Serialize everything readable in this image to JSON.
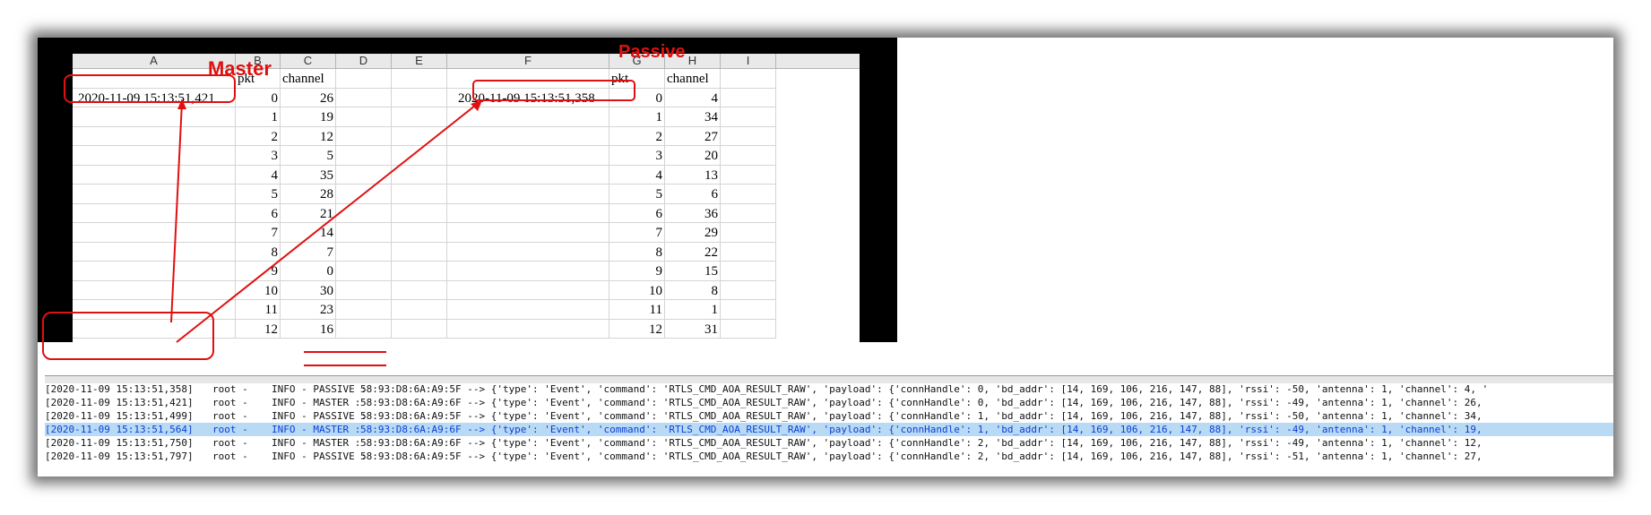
{
  "sheet": {
    "columns": [
      "A",
      "B",
      "C",
      "D",
      "E",
      "F",
      "G",
      "H",
      "I"
    ],
    "header_row": {
      "B": "pkt",
      "C": "channel",
      "G": "pkt",
      "H": "channel"
    },
    "master_timestamp": "2020-11-09 15:13:51,421",
    "passive_timestamp": "2020-11-09 15:13:51,358",
    "rows": [
      {
        "b": "0",
        "c": "26",
        "g": "0",
        "h": "4"
      },
      {
        "b": "1",
        "c": "19",
        "g": "1",
        "h": "34"
      },
      {
        "b": "2",
        "c": "12",
        "g": "2",
        "h": "27"
      },
      {
        "b": "3",
        "c": "5",
        "g": "3",
        "h": "20"
      },
      {
        "b": "4",
        "c": "35",
        "g": "4",
        "h": "13"
      },
      {
        "b": "5",
        "c": "28",
        "g": "5",
        "h": "6"
      },
      {
        "b": "6",
        "c": "21",
        "g": "6",
        "h": "36"
      },
      {
        "b": "7",
        "c": "14",
        "g": "7",
        "h": "29"
      },
      {
        "b": "8",
        "c": "7",
        "g": "8",
        "h": "22"
      },
      {
        "b": "9",
        "c": "0",
        "g": "9",
        "h": "15"
      },
      {
        "b": "10",
        "c": "30",
        "g": "10",
        "h": "8"
      },
      {
        "b": "11",
        "c": "23",
        "g": "11",
        "h": "1"
      },
      {
        "b": "12",
        "c": "16",
        "g": "12",
        "h": "31"
      }
    ]
  },
  "annotations": {
    "master_label": "Master",
    "passive_label": "Passive",
    "color": "#e01010"
  },
  "log": [
    {
      "ts": "[2020-11-09 15:13:51,358]",
      "src": "root -",
      "lvl": "INFO - PASSIVE :",
      "rest": "58:93:D8:6A:A9:5F --> {'type': 'Event', 'command': 'RTLS_CMD_AOA_RESULT_RAW', 'payload': {'connHandle': 0, 'bd_addr': [14, 169, 106, 216, 147, 88], 'rssi': -50, 'antenna': 1, 'channel': 4, '"
    },
    {
      "ts": "[2020-11-09 15:13:51,421]",
      "src": "root -",
      "lvl": "INFO - MASTER  :",
      "rest": "58:93:D8:6A:A9:6F --> {'type': 'Event', 'command': 'RTLS_CMD_AOA_RESULT_RAW', 'payload': {'connHandle': 0, 'bd_addr': [14, 169, 106, 216, 147, 88], 'rssi': -49, 'antenna': 1, 'channel': 26,"
    },
    {
      "ts": "[2020-11-09 15:13:51,499]",
      "src": "root -",
      "lvl": "INFO - PASSIVE :",
      "rest": "58:93:D8:6A:A9:5F --> {'type': 'Event', 'command': 'RTLS_CMD_AOA_RESULT_RAW', 'payload': {'connHandle': 1, 'bd_addr': [14, 169, 106, 216, 147, 88], 'rssi': -50, 'antenna': 1, 'channel': 34,"
    },
    {
      "ts": "[2020-11-09 15:13:51,564]",
      "src": "root -",
      "lvl": "INFO - MASTER  :",
      "rest": "58:93:D8:6A:A9:6F --> {'type': 'Event', 'command': 'RTLS_CMD_AOA_RESULT_RAW', 'payload': {'connHandle': 1, 'bd_addr': [14, 169, 106, 216, 147, 88], 'rssi': -49, 'antenna': 1, 'channel': 19,"
    },
    {
      "ts": "[2020-11-09 15:13:51,750]",
      "src": "root -",
      "lvl": "INFO - MASTER  :",
      "rest": "58:93:D8:6A:A9:6F --> {'type': 'Event', 'command': 'RTLS_CMD_AOA_RESULT_RAW', 'payload': {'connHandle': 2, 'bd_addr': [14, 169, 106, 216, 147, 88], 'rssi': -49, 'antenna': 1, 'channel': 12,"
    },
    {
      "ts": "[2020-11-09 15:13:51,797]",
      "src": "root -",
      "lvl": "INFO - PASSIVE :",
      "rest": "58:93:D8:6A:A9:5F --> {'type': 'Event', 'command': 'RTLS_CMD_AOA_RESULT_RAW', 'payload': {'connHandle': 2, 'bd_addr': [14, 169, 106, 216, 147, 88], 'rssi': -51, 'antenna': 1, 'channel': 27,"
    }
  ],
  "selected_log_row": 3
}
